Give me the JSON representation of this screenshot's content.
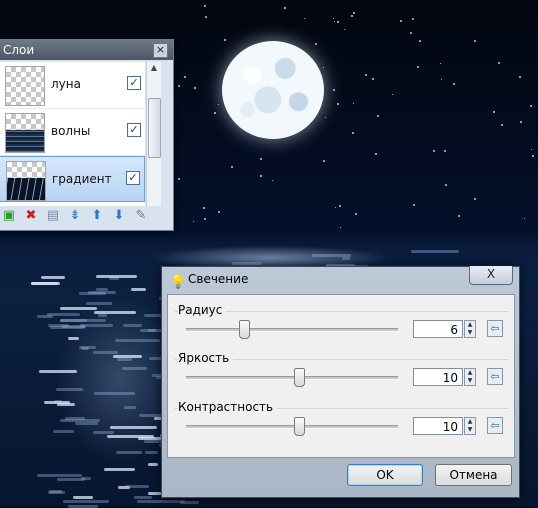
{
  "layers_panel": {
    "title": "Слои",
    "close": "×",
    "layers": [
      {
        "name": "луна",
        "visible": true,
        "selected": false
      },
      {
        "name": "волны",
        "visible": true,
        "selected": false
      },
      {
        "name": "градиент",
        "visible": true,
        "selected": true
      }
    ],
    "check_mark": "✓"
  },
  "dialog": {
    "title": "Свечение",
    "close": "X",
    "groups": [
      {
        "label": "Радиус",
        "value": "6",
        "slider_fraction": 0.28
      },
      {
        "label": "Яркость",
        "value": "10",
        "slider_fraction": 0.55
      },
      {
        "label": "Контрастность",
        "value": "10",
        "slider_fraction": 0.55
      }
    ],
    "ok": "OK",
    "cancel": "Отмена"
  }
}
